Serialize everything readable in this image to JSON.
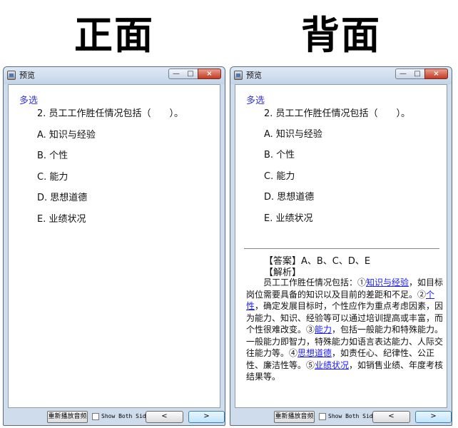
{
  "labels": {
    "front": "正面",
    "back": "背面"
  },
  "window": {
    "title": "预览",
    "controls": {
      "minimize": "—",
      "maximize": "□",
      "close": "×"
    }
  },
  "question": {
    "type": "多选",
    "text": "2. 员工工作胜任情况包括（　　）。",
    "options": [
      "A. 知识与经验",
      "B. 个性",
      "C. 能力",
      "D. 思想道德",
      "E. 业绩状况"
    ]
  },
  "answer": {
    "answer_line": "【答案】A、B、C、D、E",
    "analysis_label": "【解析】",
    "analysis": [
      {
        "text": "员工工作胜任情况包括：①"
      },
      {
        "text": "知识与经验",
        "link": true
      },
      {
        "text": "，如目标岗位需要具备的知识以及目前的差距和不足。②"
      },
      {
        "text": "个性",
        "link": true
      },
      {
        "text": "，确定发展目标时，个性应作为重点考虑因素，因为能力、知识、经验等可以通过培训提高或丰富，而个性很难改变。③"
      },
      {
        "text": "能力",
        "link": true
      },
      {
        "text": "，包括一般能力和特殊能力。一般能力即智力，特殊能力如语言表达能力、人际交往能力等。④"
      },
      {
        "text": "思想道德",
        "link": true
      },
      {
        "text": "，如责任心、纪律性、公正性、廉洁性等。⑤"
      },
      {
        "text": "业绩状况",
        "link": true
      },
      {
        "text": "，如销售业绩、年度考核结果等。"
      }
    ]
  },
  "statusbar": {
    "replay": "重新播放音频",
    "show_both": "Show Both Sides",
    "prev": "<",
    "next": ">"
  },
  "colors": {
    "type_label": "#3333cc",
    "link": "#1a1aff",
    "close_button": "#c23a22"
  }
}
